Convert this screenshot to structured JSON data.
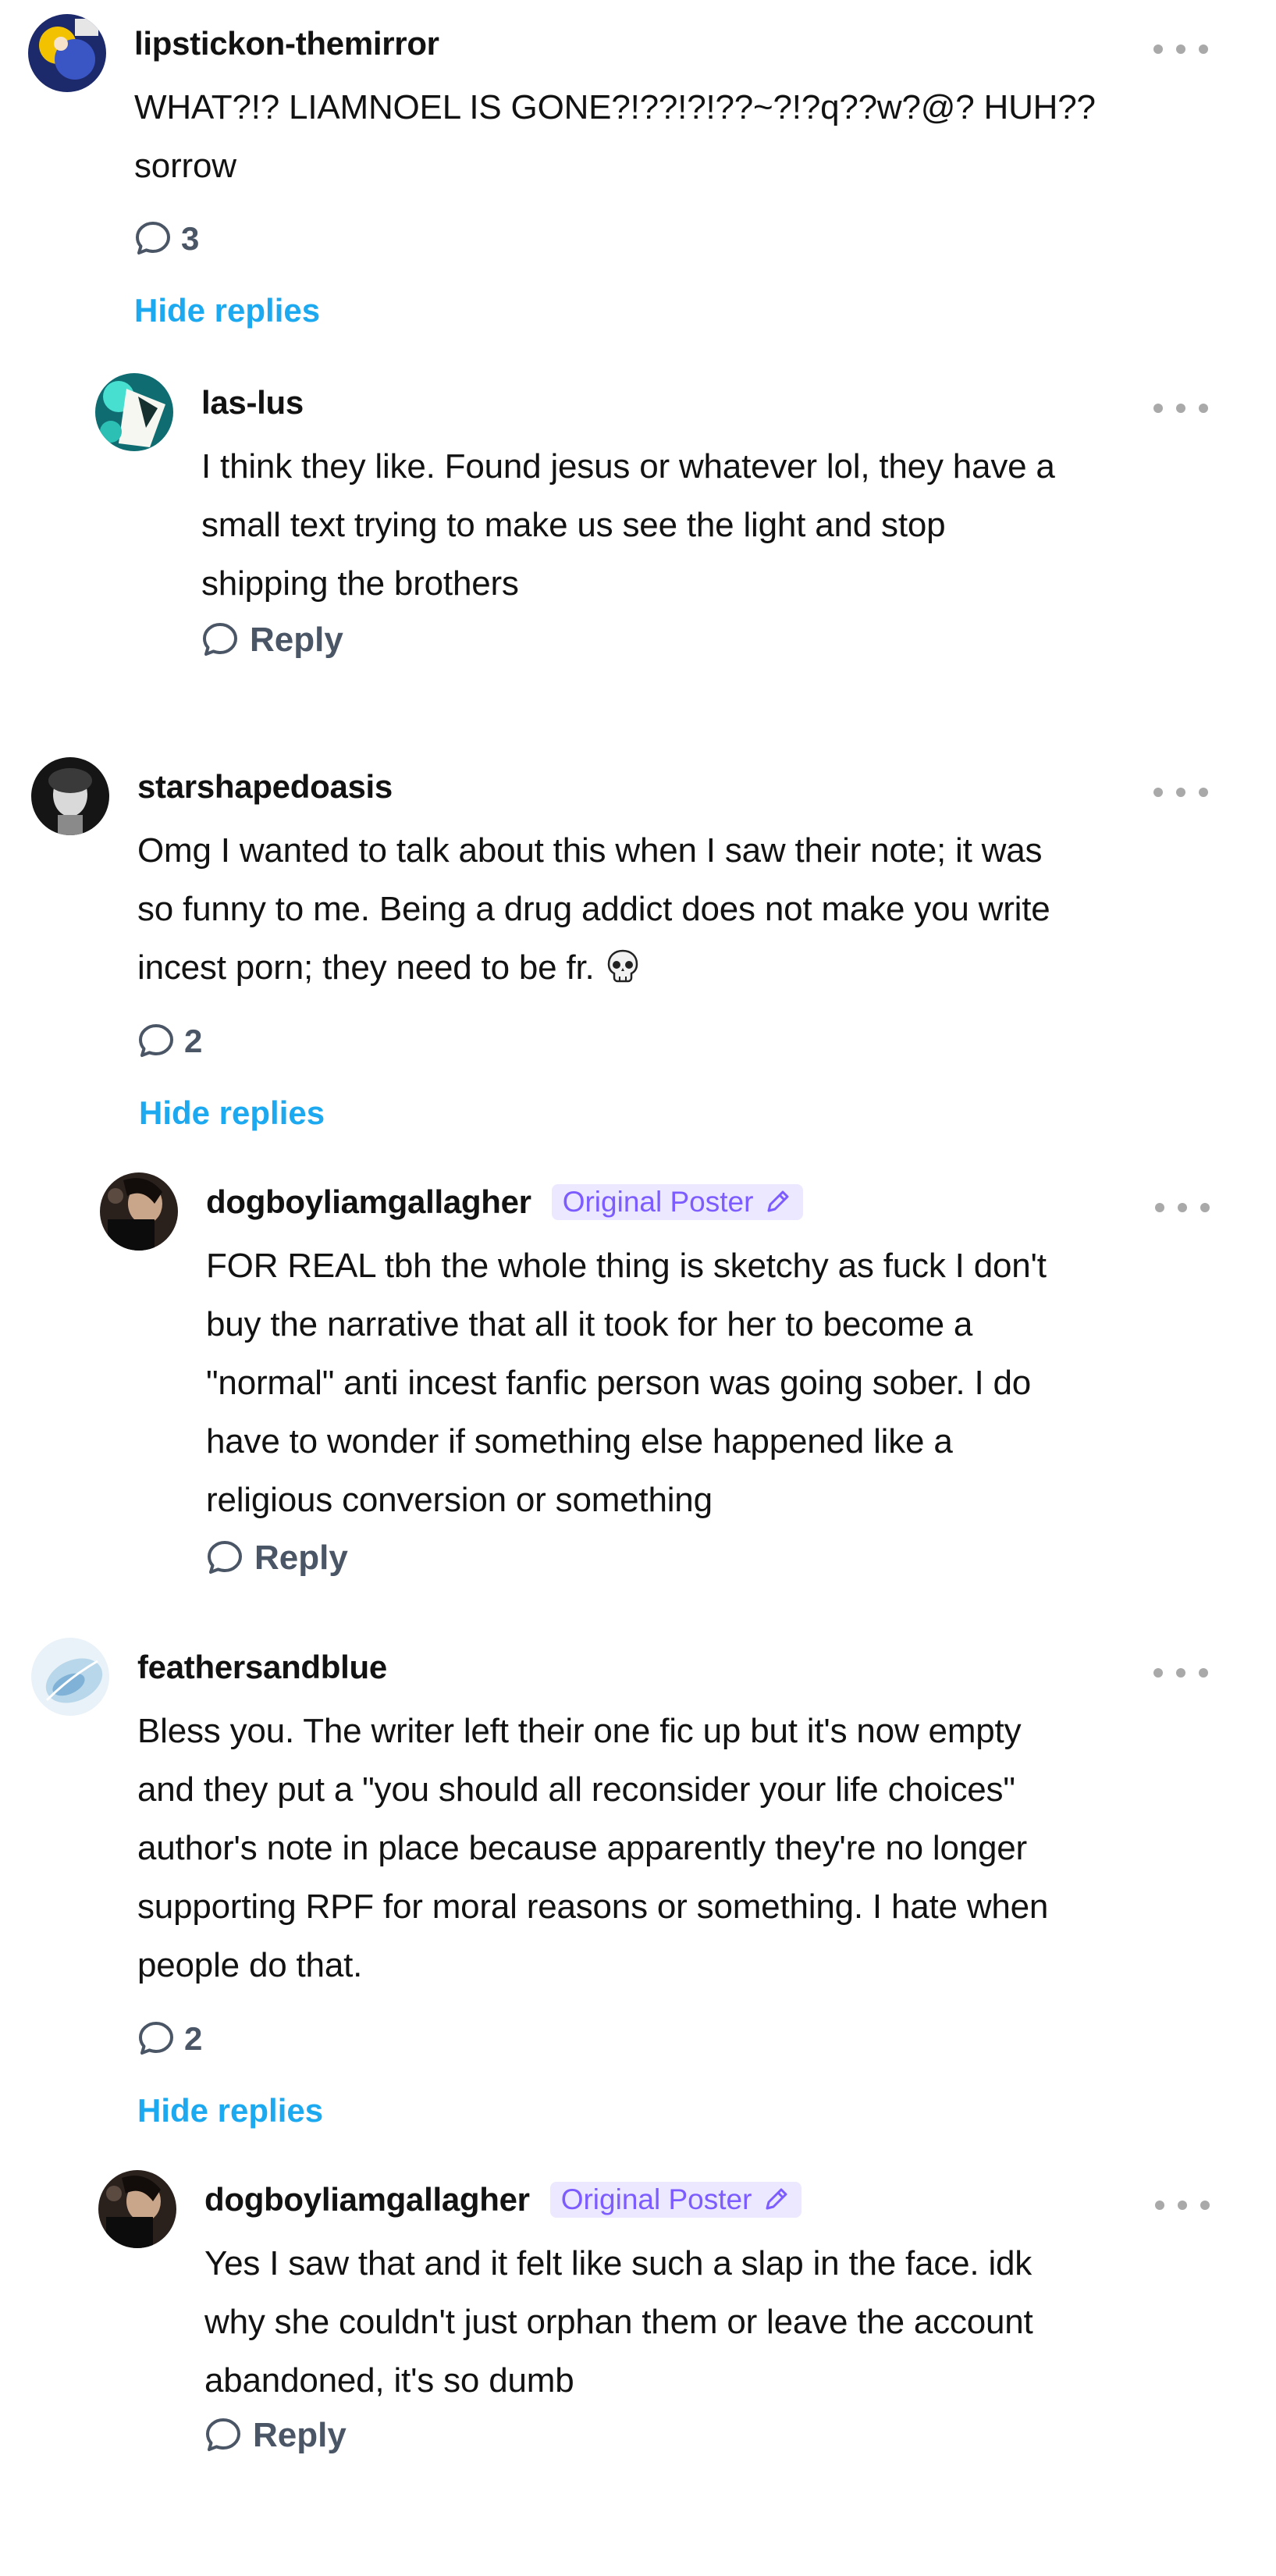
{
  "comments": [
    {
      "username": "lipstickon-themirror",
      "text": "WHAT?!? LIAMNOEL IS GONE?!??!?!??~?!?q??w?@? HUH??\nsorrow",
      "reply_count": "3",
      "hide_replies_label": "Hide replies",
      "avatar_icon": "avatar-blue-yellow",
      "replies": [
        {
          "username": "las-lus",
          "text": "I think they like. Found jesus or whatever lol, they have a\nsmall text trying to make us see the light and stop\nshipping the brothers",
          "reply_label": "Reply",
          "avatar_icon": "avatar-teal-illustration"
        }
      ]
    },
    {
      "username": "starshapedoasis",
      "text": "Omg I wanted to talk about this when I saw their note; it was\nso funny to me. Being a drug addict does not make you write\nincest porn; they need to be fr.",
      "emoji": "skull-emoji",
      "reply_count": "2",
      "hide_replies_label": "Hide replies",
      "avatar_icon": "avatar-bw-photo",
      "replies": [
        {
          "username": "dogboyliamgallagher",
          "badge": "Original Poster",
          "text": "FOR REAL tbh the whole thing is sketchy as fuck I don't\nbuy the narrative that all it took for her to become a\n\"normal\" anti incest fanfic person was going sober. I do\nhave to wonder if something else happened like a\nreligious conversion or something",
          "reply_label": "Reply",
          "avatar_icon": "avatar-dark-photo"
        }
      ]
    },
    {
      "username": "feathersandblue",
      "text": "Bless you. The writer left their one fic up but it's now empty\nand they put a \"you should all reconsider your life choices\"\nauthor's note in place because apparently they're no longer\nsupporting RPF for moral reasons or something. I hate when\npeople do that.",
      "reply_count": "2",
      "hide_replies_label": "Hide replies",
      "avatar_icon": "avatar-light-blue-feather",
      "replies": [
        {
          "username": "dogboyliamgallagher",
          "badge": "Original Poster",
          "text": "Yes I saw that and it felt like such a slap in the face. idk\nwhy she couldn't just orphan them or leave the account\nabandoned, it's so dumb",
          "reply_label": "Reply",
          "avatar_icon": "avatar-dark-photo"
        }
      ]
    }
  ],
  "colors": {
    "link_blue": "#1da9f0",
    "op_badge_bg": "#ece8ff",
    "op_badge_text": "#7c5cff",
    "meta_gray": "#4a5565"
  }
}
